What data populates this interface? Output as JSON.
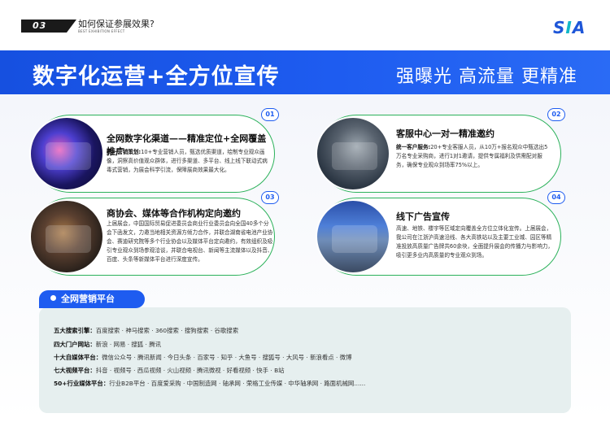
{
  "header": {
    "section_number": "03",
    "section_title": "如何保证参展效果?",
    "section_subtitle": "BEST EXHIBITION EFFECT",
    "logo_text_a": "S",
    "logo_text_b": "I",
    "logo_text_c": "A"
  },
  "banner": {
    "left_text": "数字化运营+全方位宣传",
    "right_text": "强曝光 高流量 更精准"
  },
  "cards": [
    {
      "badge": "01",
      "title": "全网数字化渠道——精准定位+全网覆盖推广",
      "body_lead": "统一营销策划:",
      "body": "10+专业营销人员，甄选优质渠道，绘制专业观众画像，洞察高价值观众群体，进行多渠道、多平台、线上线下联动式病毒式营销，为展会科学引流，保障展商效果最大化。"
    },
    {
      "badge": "02",
      "title": "客服中心一对一精准邀约",
      "body_lead": "统一客户服务:",
      "body": "20+专业客服人员，从10万+报名观众中甄选出5万名专业采购商，进行1对1邀请，提供专属福利及供需配对服务，确保专业观众到场率75%以上。"
    },
    {
      "badge": "03",
      "title": "商协会、媒体等合作机构定向邀约",
      "body_lead": "",
      "body": "上届展会，中国国际贸易促进委员会商业行业委员会向全国40多个分会下函发文，力邀当地相关资源方倾力合作，并联合湖南省电池产业协会、赛迪研究院等多个行业协会以及媒体平台定向邀约，有效组织及吸引专业观众到场参观洽谈，并联合电视台、新闻等主流媒体以及抖音、百度、头条等新媒体平台进行深度宣传。"
    },
    {
      "badge": "04",
      "title": "线下广告宣传",
      "body_lead": "",
      "body": "高速、地铁、楼宇等区域定向覆盖全方位立体化宣传。上届展会，我公司在江浙沪高速沿线、各大高铁站以及主要工业城、园区等精准投放高质量广告牌共60余块，全面提升展会的传播力与影响力，吸引更多业内高质量的专业观众到场。"
    }
  ],
  "platform": {
    "tag": "全网营销平台",
    "rows": [
      {
        "label": "五大搜索引擎：",
        "items": "百度搜索 · 神马搜索 · 360搜索 · 搜狗搜索 · 谷歌搜索"
      },
      {
        "label": "四大门户网站：",
        "items": "新浪 · 网易 · 搜狐 · 腾讯"
      },
      {
        "label": "十大自媒体平台：",
        "items": "微信公众号 · 腾讯新闻 · 今日头条 · 百家号 · 知乎 · 大鱼号 · 搜狐号 · 大风号 · 新浪看点 · 微博"
      },
      {
        "label": "七大视频平台：",
        "items": "抖音 · 视频号 · 西瓜视频 · 火山视频 · 腾讯微视 · 好看视频 · 快手 · B站"
      },
      {
        "label": "50+行业媒体平台：",
        "items": "行业B2B平台 · 百度爱采购 · 中国制造网 · 轴承网 · 荣格工业传媒 · 中华轴承网 · 路面机械网......"
      }
    ]
  },
  "colors": {
    "primary_blue": "#1e5cf0",
    "card_border_green": "#2bb15a",
    "panel_bg": "#e6efef"
  },
  "icons": {
    "card1_photo": "digital-marketing-image",
    "card2_photo": "call-center-agent-image",
    "card3_photo": "media-press-image",
    "card4_photo": "billboard-ad-image"
  }
}
